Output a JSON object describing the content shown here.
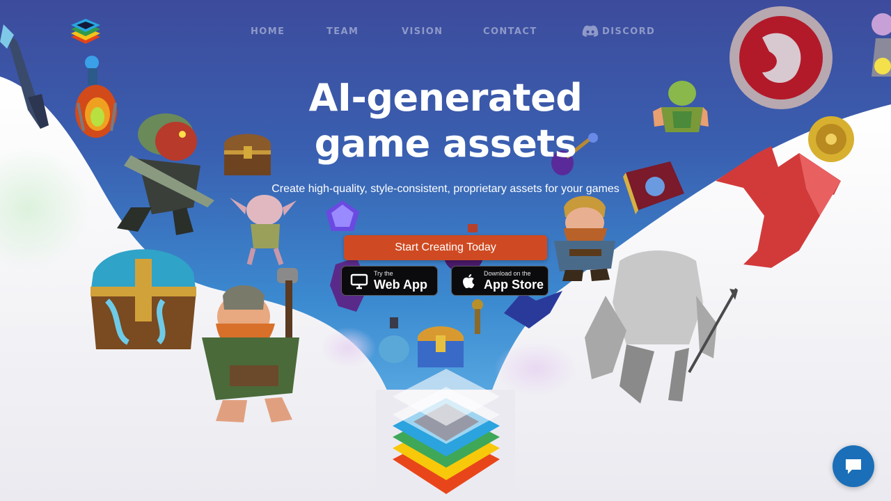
{
  "nav": {
    "links": [
      "HOME",
      "TEAM",
      "VISION",
      "CONTACT"
    ],
    "discord_label": "DISCORD"
  },
  "hero": {
    "title": "AI-generated game assets",
    "subtitle": "Create high-quality, style-consistent, proprietary assets for your games",
    "cta_label": "Start Creating Today"
  },
  "store_buttons": {
    "web": {
      "small": "Try the",
      "big": "Web App"
    },
    "appstore": {
      "small": "Download on the",
      "big": "App Store"
    }
  },
  "colors": {
    "accent": "#cf4a22",
    "sky_top": "#3d4b9c",
    "sky_bottom": "#5fb0e6",
    "chat": "#1a6fb8",
    "nav_text": "#8f9ac9"
  },
  "icons": {
    "logo": "layered-diamond-logo",
    "discord": "discord-icon",
    "web": "monitor-icon",
    "appstore": "apple-icon",
    "chat": "chat-bubble-icon"
  }
}
